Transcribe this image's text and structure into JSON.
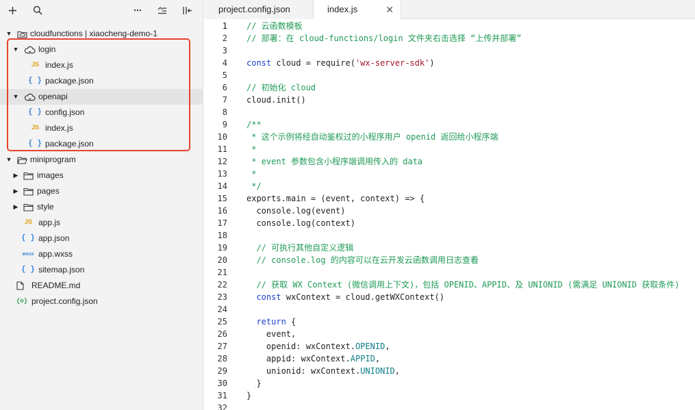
{
  "sidebar": {
    "toolbar": {
      "add_icon": "plus-icon",
      "search_icon": "search-icon",
      "more_icon": "more-icon",
      "collapse_icon": "collapse-icon",
      "split_icon": "split-icon"
    },
    "tree": [
      {
        "id": "cloudfunctions",
        "label": "cloudfunctions | xiaocheng-demo-1",
        "type": "folder-cloud-root",
        "depth": 0,
        "expanded": true
      },
      {
        "id": "login",
        "label": "login",
        "type": "cloud-folder",
        "depth": 1,
        "expanded": true
      },
      {
        "id": "login-index",
        "label": "index.js",
        "type": "js",
        "depth": 2
      },
      {
        "id": "login-package",
        "label": "package.json",
        "type": "json",
        "depth": 2
      },
      {
        "id": "openapi",
        "label": "openapi",
        "type": "cloud-folder",
        "depth": 1,
        "expanded": true,
        "selected": true
      },
      {
        "id": "openapi-config",
        "label": "config.json",
        "type": "json",
        "depth": 2
      },
      {
        "id": "openapi-index",
        "label": "index.js",
        "type": "js",
        "depth": 2
      },
      {
        "id": "openapi-package",
        "label": "package.json",
        "type": "json",
        "depth": 2
      },
      {
        "id": "miniprogram",
        "label": "miniprogram",
        "type": "folder-open",
        "depth": 0,
        "expanded": true
      },
      {
        "id": "images",
        "label": "images",
        "type": "folder",
        "depth": 1,
        "expanded": false
      },
      {
        "id": "pages",
        "label": "pages",
        "type": "folder",
        "depth": 1,
        "expanded": false
      },
      {
        "id": "style",
        "label": "style",
        "type": "folder",
        "depth": 1,
        "expanded": false
      },
      {
        "id": "app-js",
        "label": "app.js",
        "type": "js",
        "depth": 1
      },
      {
        "id": "app-json",
        "label": "app.json",
        "type": "json",
        "depth": 1
      },
      {
        "id": "app-wxss",
        "label": "app.wxss",
        "type": "wxss",
        "depth": 1
      },
      {
        "id": "sitemap",
        "label": "sitemap.json",
        "type": "json",
        "depth": 1
      },
      {
        "id": "readme",
        "label": "README.md",
        "type": "md",
        "depth": 0
      },
      {
        "id": "project-config",
        "label": "project.config.json",
        "type": "config",
        "depth": 0
      }
    ],
    "icon_text": {
      "js": "JS",
      "json": "{ }",
      "wxss": "wxss",
      "config": "{o}"
    }
  },
  "tabs": [
    {
      "label": "project.config.json",
      "active": false
    },
    {
      "label": "index.js",
      "active": true,
      "close": "✕"
    }
  ],
  "editor": {
    "active_line": 1,
    "lines": [
      [
        [
          "c",
          "// 云函数模板"
        ]
      ],
      [
        [
          "c",
          "// 部署：在 cloud-functions/login 文件夹右击选择 “上传并部署”"
        ]
      ],
      [],
      [
        [
          "k",
          "const"
        ],
        [
          "t",
          " cloud = require("
        ],
        [
          "s",
          "'wx-server-sdk'"
        ],
        [
          "t",
          ")"
        ]
      ],
      [],
      [
        [
          "c",
          "// 初始化 cloud"
        ]
      ],
      [
        [
          "t",
          "cloud.init()"
        ]
      ],
      [],
      [
        [
          "c",
          "/**"
        ]
      ],
      [
        [
          "c",
          " * 这个示例将经自动鉴权过的小程序用户 openid 返回给小程序端"
        ]
      ],
      [
        [
          "c",
          " *"
        ]
      ],
      [
        [
          "c",
          " * event 参数包含小程序端调用传入的 data"
        ]
      ],
      [
        [
          "c",
          " *"
        ]
      ],
      [
        [
          "c",
          " */"
        ]
      ],
      [
        [
          "t",
          "exports.main = (event, context) => {"
        ]
      ],
      [
        [
          "t",
          "  console.log(event)"
        ]
      ],
      [
        [
          "t",
          "  console.log(context)"
        ]
      ],
      [],
      [
        [
          "t",
          "  "
        ],
        [
          "c",
          "// 可执行其他自定义逻辑"
        ]
      ],
      [
        [
          "t",
          "  "
        ],
        [
          "c",
          "// console.log 的内容可以在云开发云函数调用日志查看"
        ]
      ],
      [],
      [
        [
          "t",
          "  "
        ],
        [
          "c",
          "// 获取 WX Context (微信调用上下文)，包括 OPENID、APPID、及 UNIONID (需满足 UNIONID 获取条件)"
        ]
      ],
      [
        [
          "t",
          "  "
        ],
        [
          "k",
          "const"
        ],
        [
          "t",
          " wxContext = cloud.getWXContext()"
        ]
      ],
      [],
      [
        [
          "t",
          "  "
        ],
        [
          "k",
          "return"
        ],
        [
          "t",
          " {"
        ]
      ],
      [
        [
          "t",
          "    event,"
        ]
      ],
      [
        [
          "t",
          "    openid: wxContext."
        ],
        [
          "p",
          "OPENID"
        ],
        [
          "t",
          ","
        ]
      ],
      [
        [
          "t",
          "    appid: wxContext."
        ],
        [
          "p",
          "APPID"
        ],
        [
          "t",
          ","
        ]
      ],
      [
        [
          "t",
          "    unionid: wxContext."
        ],
        [
          "p",
          "UNIONID"
        ],
        [
          "t",
          ","
        ]
      ],
      [
        [
          "t",
          "  }"
        ]
      ],
      [
        [
          "t",
          "}"
        ]
      ],
      []
    ]
  },
  "colors": {
    "highlight_border": "#e8412c",
    "comment": "#1f9a55",
    "keyword": "#1a3ecf",
    "string": "#a3152d",
    "property": "#0e7c86"
  }
}
